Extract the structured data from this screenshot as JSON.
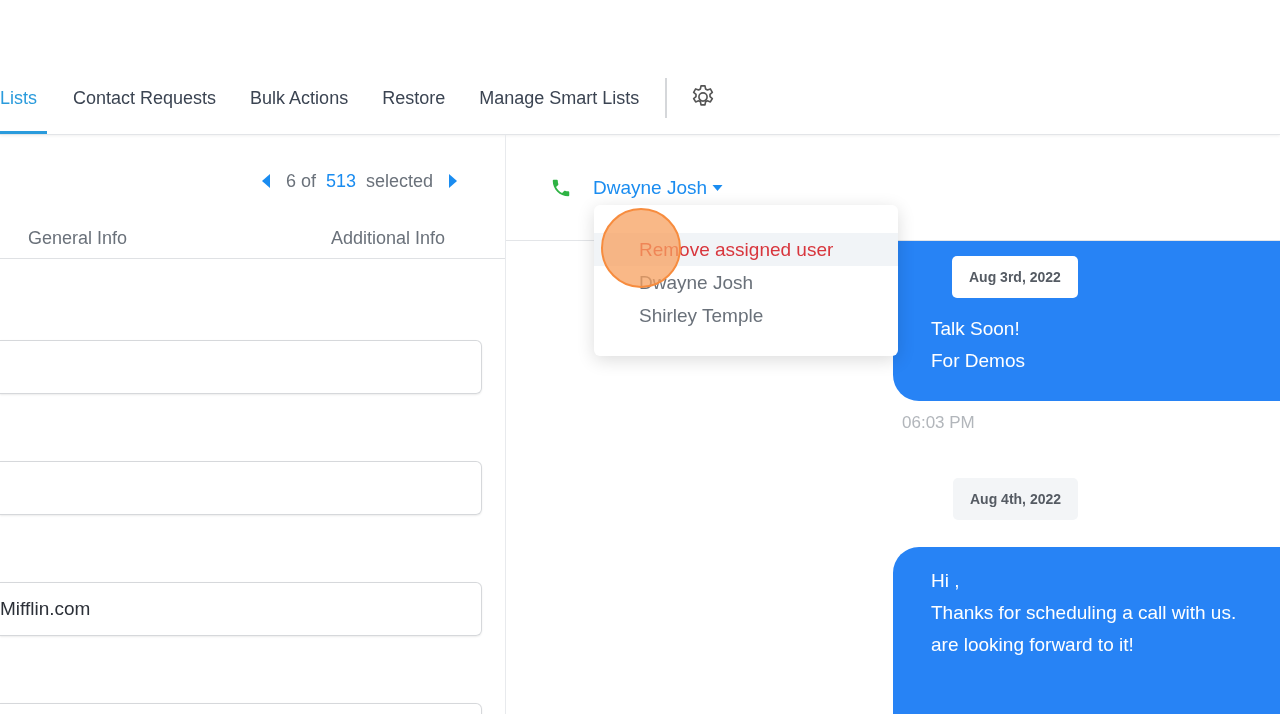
{
  "tabs": [
    {
      "label": "Lists",
      "selected": true
    },
    {
      "label": "Contact Requests",
      "selected": false
    },
    {
      "label": "Bulk Actions",
      "selected": false
    },
    {
      "label": "Restore",
      "selected": false
    },
    {
      "label": "Manage Smart Lists",
      "selected": false
    }
  ],
  "pager": {
    "position": "6 of",
    "total": "513",
    "suffix": "selected"
  },
  "detail_tabs": [
    {
      "label": "General Info",
      "selected": false
    },
    {
      "label": "Additional Info",
      "selected": false
    }
  ],
  "fields": [
    {
      "kind": "empty"
    },
    {
      "kind": "empty"
    },
    {
      "kind": "text",
      "value": "Mifflin.com"
    },
    {
      "kind": "empty"
    }
  ],
  "conversation": {
    "assigned_user": "Dwayne Josh",
    "user_menu": [
      {
        "label": "Remove assigned user",
        "kind": "remove",
        "highlighted": true
      },
      {
        "label": "Dwayne Josh",
        "kind": "user",
        "highlighted": false
      },
      {
        "label": "Shirley Temple",
        "kind": "user",
        "highlighted": false
      }
    ],
    "messages": [
      {
        "date": "Aug 3rd, 2022",
        "lines": [
          "Talk Soon!",
          "For Demos"
        ],
        "time": "06:03 PM"
      },
      {
        "date": "Aug 4th, 2022",
        "lines": [
          "Hi ,",
          "Thanks for scheduling a call with us.",
          "are looking forward to it!"
        ]
      }
    ]
  }
}
